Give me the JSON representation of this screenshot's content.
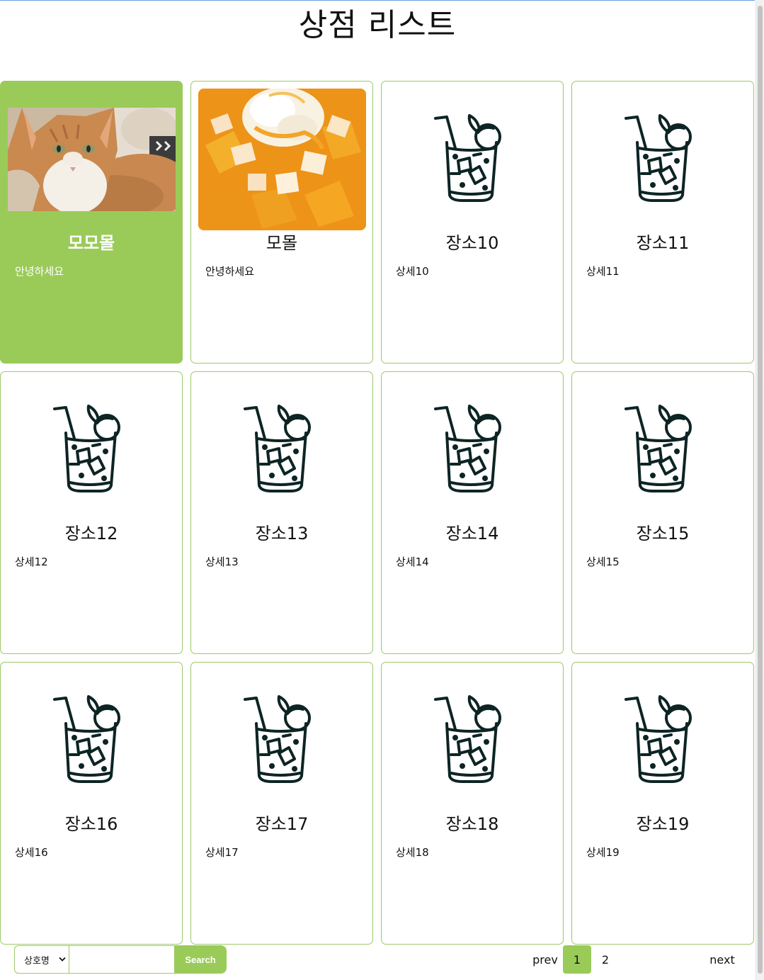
{
  "page": {
    "title": "상점 리스트"
  },
  "colors": {
    "accent": "#9acb59",
    "card_border": "#9cc96a",
    "icon": "#0d2424"
  },
  "stores": [
    {
      "name": "모모몰",
      "description": "안녕하세요",
      "image": "cat-photo",
      "active": true
    },
    {
      "name": "모몰",
      "description": "안녕하세요",
      "image": "mango-bingsu-photo",
      "active": false
    },
    {
      "name": "장소10",
      "description": "상세10",
      "image": "iced-drink-icon",
      "active": false
    },
    {
      "name": "장소11",
      "description": "상세11",
      "image": "iced-drink-icon",
      "active": false
    },
    {
      "name": "장소12",
      "description": "상세12",
      "image": "iced-drink-icon",
      "active": false
    },
    {
      "name": "장소13",
      "description": "상세13",
      "image": "iced-drink-icon",
      "active": false
    },
    {
      "name": "장소14",
      "description": "상세14",
      "image": "iced-drink-icon",
      "active": false
    },
    {
      "name": "장소15",
      "description": "상세15",
      "image": "iced-drink-icon",
      "active": false
    },
    {
      "name": "장소16",
      "description": "상세16",
      "image": "iced-drink-icon",
      "active": false
    },
    {
      "name": "장소17",
      "description": "상세17",
      "image": "iced-drink-icon",
      "active": false
    },
    {
      "name": "장소18",
      "description": "상세18",
      "image": "iced-drink-icon",
      "active": false
    },
    {
      "name": "장소19",
      "description": "상세19",
      "image": "iced-drink-icon",
      "active": false
    }
  ],
  "search": {
    "category_selected": "상호명",
    "query": "",
    "button_label": "Search"
  },
  "pagination": {
    "prev_label": "prev",
    "pages": [
      "1",
      "2"
    ],
    "current_page": "1",
    "next_label": "next"
  }
}
